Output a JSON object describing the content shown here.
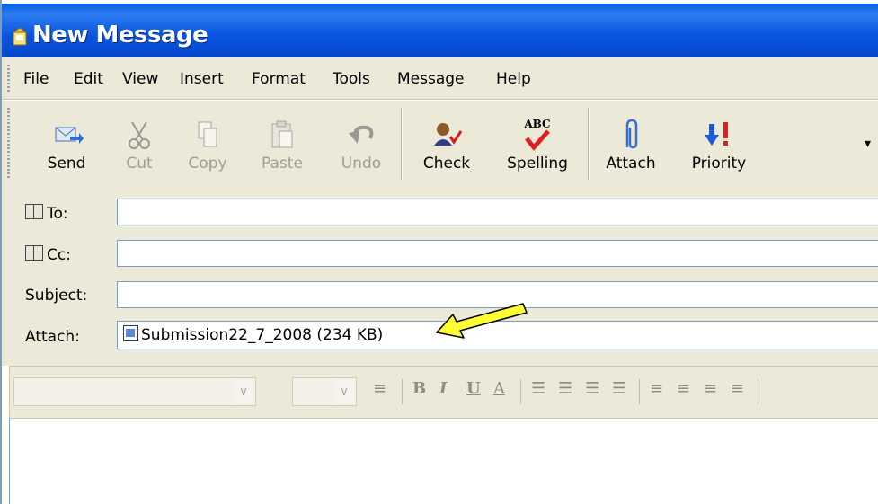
{
  "window": {
    "title": "New Message"
  },
  "menu": [
    "File",
    "Edit",
    "View",
    "Insert",
    "Format",
    "Tools",
    "Message",
    "Help"
  ],
  "toolbar": [
    {
      "label": "Send",
      "icon": "send-icon",
      "enabled": true
    },
    {
      "label": "Cut",
      "icon": "scissors-icon",
      "enabled": false
    },
    {
      "label": "Copy",
      "icon": "copy-icon",
      "enabled": false
    },
    {
      "label": "Paste",
      "icon": "paste-icon",
      "enabled": false
    },
    {
      "label": "Undo",
      "icon": "undo-icon",
      "enabled": false
    },
    {
      "label": "Check",
      "icon": "check-names-icon",
      "enabled": true
    },
    {
      "label": "Spelling",
      "icon": "spelling-icon",
      "enabled": true,
      "icon_text": "ABC"
    },
    {
      "label": "Attach",
      "icon": "paperclip-icon",
      "enabled": true
    },
    {
      "label": "Priority",
      "icon": "priority-icon",
      "enabled": true
    }
  ],
  "headers": {
    "to_label": "To:",
    "cc_label": "Cc:",
    "subject_label": "Subject:",
    "attach_label": "Attach:",
    "to_value": "",
    "cc_value": "",
    "subject_value": "",
    "attachment": "Submission22_7_2008 (234 KB)"
  },
  "format_toolbar": {
    "bold": "B",
    "italic": "I",
    "underline": "U",
    "font_color": "A"
  },
  "colors": {
    "titlebar": "#0a5ee0",
    "chrome": "#ece9d8",
    "annotation_arrow": "#ffff33"
  }
}
